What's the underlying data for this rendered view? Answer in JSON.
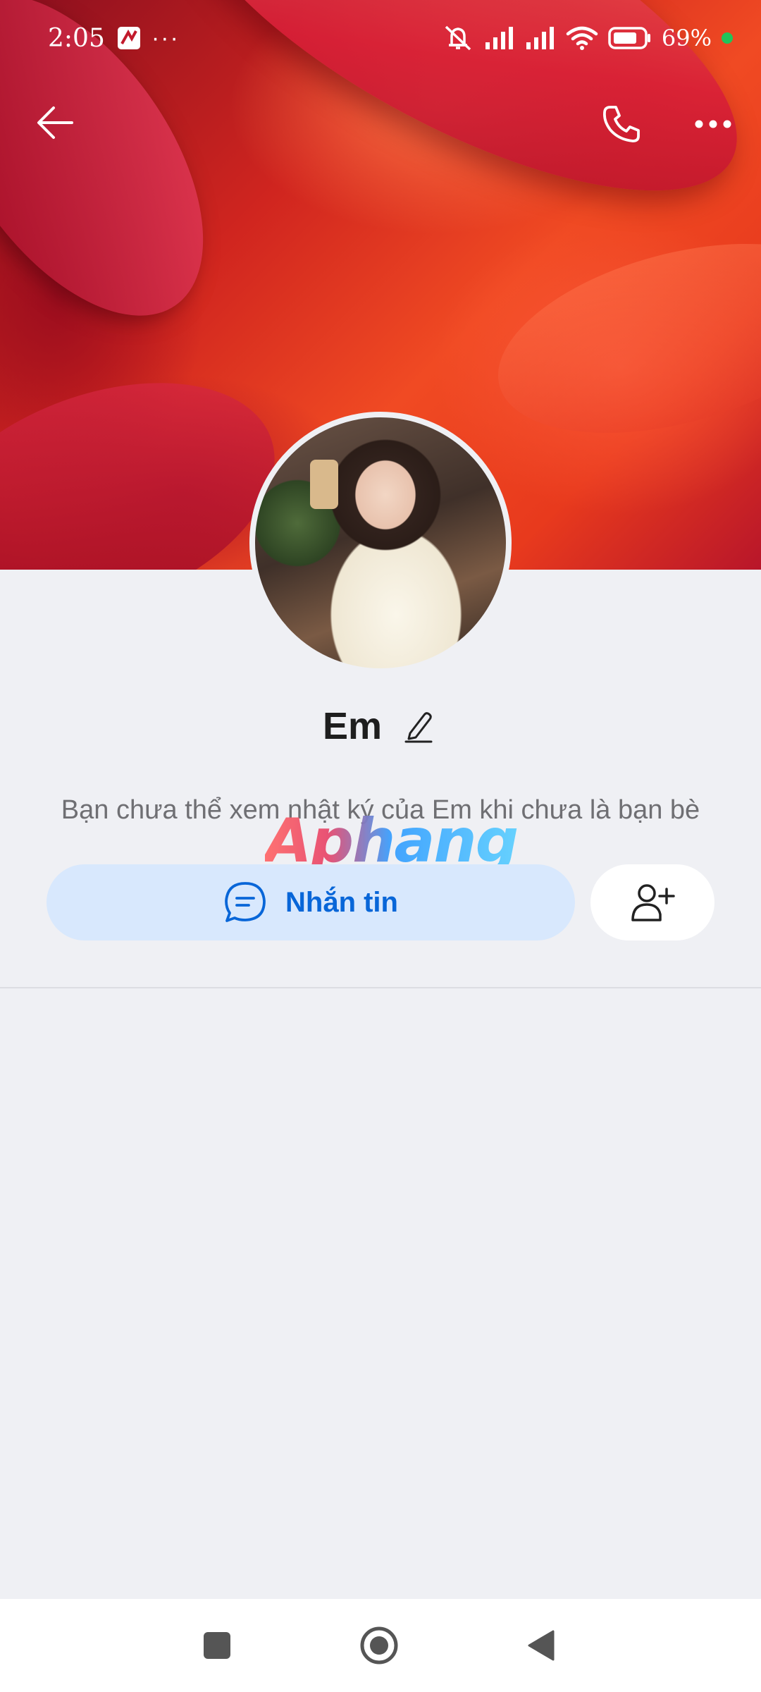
{
  "status_bar": {
    "time": "2:05",
    "battery": "69%",
    "icons": [
      "app-notification-icon",
      "more-dots-icon",
      "mute-icon",
      "signal-icon",
      "signal-icon",
      "wifi-icon",
      "battery-icon",
      "charging-dot"
    ]
  },
  "top_bar": {
    "icons": [
      "back-arrow-icon",
      "phone-icon",
      "more-horizontal-icon"
    ]
  },
  "profile": {
    "name": "Em",
    "notice": "Bạn chưa thể xem nhật ký của Em khi chưa là bạn bè",
    "watermark": "Aphang"
  },
  "actions": {
    "message_label": "Nhắn tin",
    "message_icon": "chat-bubble-icon",
    "add_friend_icon": "add-user-icon"
  },
  "colors": {
    "background": "#eff0f4",
    "message_button_bg": "#d8e8fd",
    "accent": "#0866d8",
    "text_secondary": "#6f6f73",
    "charging": "#21c45a"
  },
  "nav_bar": {
    "icons": [
      "recents-square-icon",
      "home-circle-icon",
      "back-triangle-icon"
    ]
  }
}
